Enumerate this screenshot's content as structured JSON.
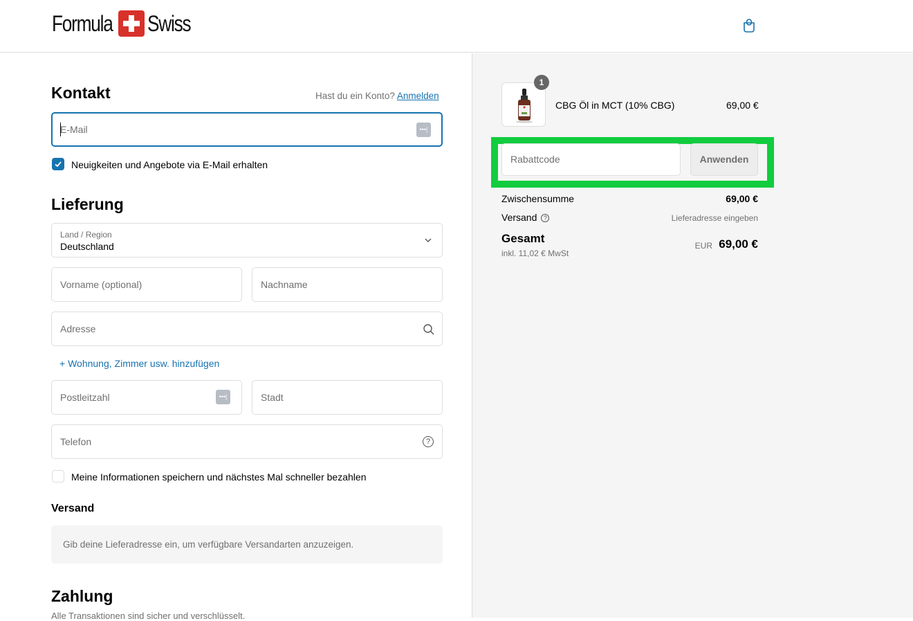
{
  "header": {
    "brand_left": "Formula",
    "brand_right": "Swiss",
    "cart_icon": "shopping-bag-icon"
  },
  "contact": {
    "title": "Kontakt",
    "account_prompt": "Hast du ein Konto?",
    "login_link": "Anmelden",
    "email_placeholder": "E-Mail",
    "newsletter_label": "Neuigkeiten und Angebote via E-Mail erhalten",
    "newsletter_checked": true
  },
  "delivery": {
    "title": "Lieferung",
    "country_label": "Land / Region",
    "country_value": "Deutschland",
    "first_name_placeholder": "Vorname (optional)",
    "last_name_placeholder": "Nachname",
    "address_placeholder": "Adresse",
    "add_apartment_link": "Wohnung, Zimmer usw. hinzufügen",
    "postal_placeholder": "Postleitzahl",
    "city_placeholder": "Stadt",
    "phone_placeholder": "Telefon",
    "save_info_label": "Meine Informationen speichern und nächstes Mal schneller bezahlen",
    "save_info_checked": false
  },
  "shipping": {
    "title": "Versand",
    "info": "Gib deine Lieferadresse ein, um verfügbare Versandarten anzuzeigen."
  },
  "payment": {
    "title": "Zahlung",
    "subtitle": "Alle Transaktionen sind sicher und verschlüsselt."
  },
  "summary": {
    "items": [
      {
        "name": "CBG Öl in MCT (10% CBG)",
        "price": "69,00 €",
        "quantity": "1"
      }
    ],
    "discount_placeholder": "Rabattcode",
    "apply_label": "Anwenden",
    "subtotal_label": "Zwischensumme",
    "subtotal_value": "69,00 €",
    "shipping_label": "Versand",
    "shipping_value": "Lieferadresse eingeben",
    "total_label": "Gesamt",
    "tax_note": "inkl. 11,02 € MwSt",
    "currency": "EUR",
    "total_value": "69,00 €"
  },
  "colors": {
    "accent": "#1773b0",
    "highlight": "#12cc3f",
    "brand_red": "#d8312b"
  }
}
